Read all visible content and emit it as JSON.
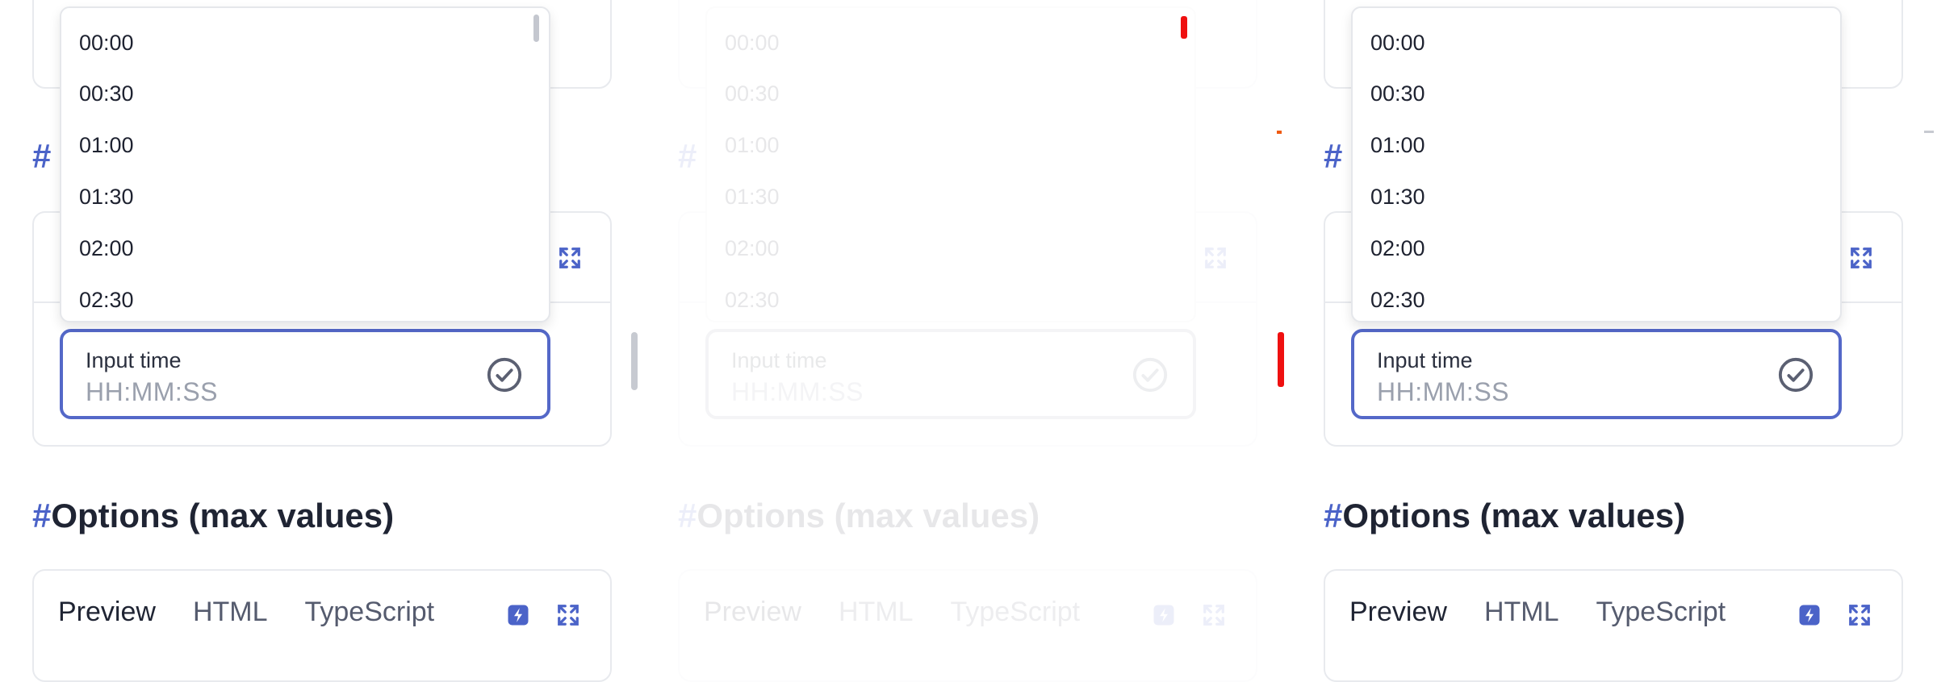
{
  "dropdown_options": [
    "00:00",
    "00:30",
    "01:00",
    "01:30",
    "02:00",
    "02:30"
  ],
  "input": {
    "label": "Input time",
    "placeholder": "HH:MM:SS"
  },
  "section": {
    "hash": "#",
    "options_title": "Options (max values)"
  },
  "tabs": {
    "preview": "Preview",
    "html": "HTML",
    "typescript": "TypeScript"
  },
  "icons": {
    "expand": "expand-icon",
    "flash": "flash-icon",
    "check": "check-circle-icon"
  },
  "colors": {
    "accent": "#4b63c8",
    "input_border": "#5468c8",
    "error": "#ef1010"
  }
}
